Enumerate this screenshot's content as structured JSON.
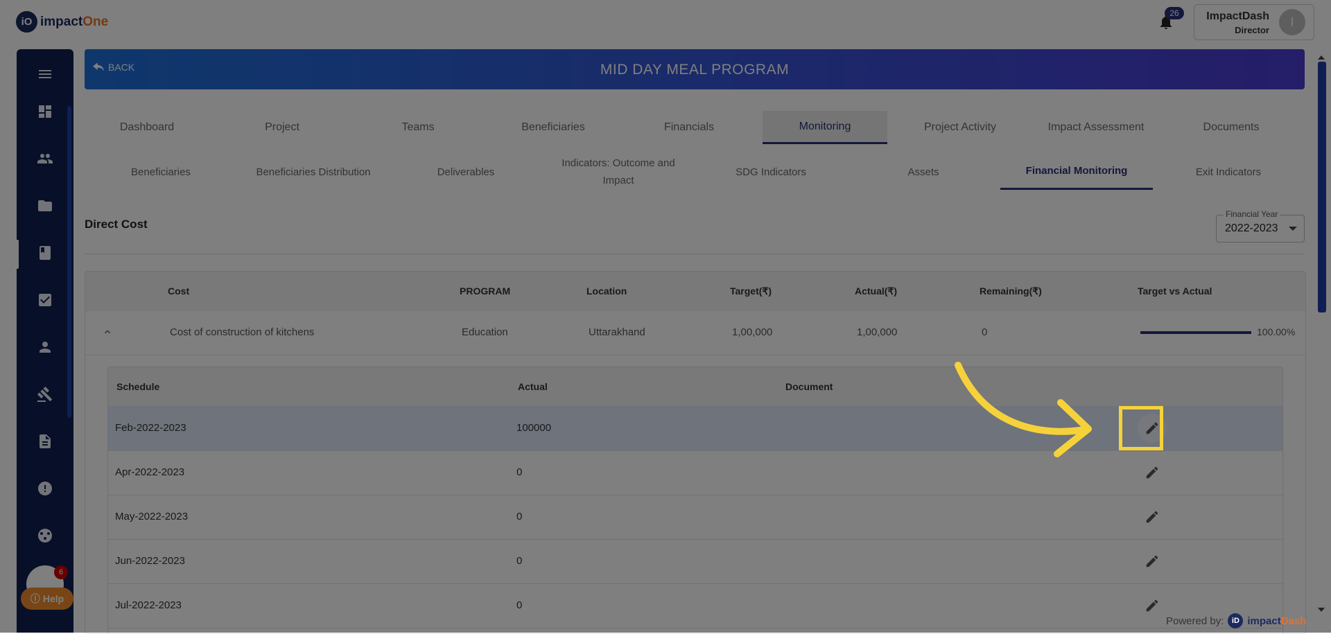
{
  "app": {
    "logo_mark": "iO",
    "logo_text_a": "impact",
    "logo_text_b": "One"
  },
  "header": {
    "notification_count": "26",
    "user_name": "ImpactDash",
    "user_role": "Director",
    "avatar_initial": "I"
  },
  "sidebar": {
    "icons": [
      "menu-icon",
      "dashboard-icon",
      "people-icon",
      "folder-icon",
      "book-icon",
      "checkbox-icon",
      "person-icon",
      "gavel-icon",
      "document-icon",
      "alert-icon",
      "network-icon"
    ],
    "chat_badge": "6",
    "help_label": "Help"
  },
  "banner": {
    "back_label": "BACK",
    "title": "MID DAY MEAL PROGRAM"
  },
  "tabs": [
    {
      "label": "Dashboard",
      "active": false
    },
    {
      "label": "Project",
      "active": false
    },
    {
      "label": "Teams",
      "active": false
    },
    {
      "label": "Beneficiaries",
      "active": false
    },
    {
      "label": "Financials",
      "active": false
    },
    {
      "label": "Monitoring",
      "active": true
    },
    {
      "label": "Project Activity",
      "active": false
    },
    {
      "label": "Impact Assessment",
      "active": false
    },
    {
      "label": "Documents",
      "active": false
    }
  ],
  "subtabs": [
    {
      "label": "Beneficiaries",
      "active": false
    },
    {
      "label": "Beneficiaries Distribution",
      "active": false
    },
    {
      "label": "Deliverables",
      "active": false
    },
    {
      "label": "Indicators: Outcome and Impact",
      "active": false
    },
    {
      "label": "SDG Indicators",
      "active": false
    },
    {
      "label": "Assets",
      "active": false
    },
    {
      "label": "Financial Monitoring",
      "active": true
    },
    {
      "label": "Exit Indicators",
      "active": false
    }
  ],
  "section": {
    "title": "Direct Cost"
  },
  "financial_year": {
    "label": "Financial Year",
    "value": "2022-2023"
  },
  "table": {
    "columns": [
      "Cost",
      "PROGRAM",
      "Location",
      "Target(₹)",
      "Actual(₹)",
      "Remaining(₹)",
      "Target vs Actual"
    ],
    "row": {
      "cost": "Cost of construction of kitchens",
      "program": "Education",
      "location": "Uttarakhand",
      "target": "1,00,000",
      "actual": "1,00,000",
      "remaining": "0",
      "progress_percent": 100,
      "progress_label": "100.00%"
    }
  },
  "schedule_table": {
    "columns": [
      "Schedule",
      "Actual",
      "Document"
    ],
    "rows": [
      {
        "schedule": "Feb-2022-2023",
        "actual": "100000"
      },
      {
        "schedule": "Apr-2022-2023",
        "actual": "0"
      },
      {
        "schedule": "May-2022-2023",
        "actual": "0"
      },
      {
        "schedule": "Jun-2022-2023",
        "actual": "0"
      },
      {
        "schedule": "Jul-2022-2023",
        "actual": "0"
      }
    ]
  },
  "footer": {
    "powered_label": "Powered by:",
    "brand_mark": "iD",
    "brand_a": "impact",
    "brand_b": "Dash"
  },
  "colors": {
    "accent": "#2a2f7a",
    "banner_start": "#1d6fd8",
    "banner_end": "#4b3bd1",
    "highlight": "#f6d23a",
    "sidebar": "#0f2150"
  }
}
